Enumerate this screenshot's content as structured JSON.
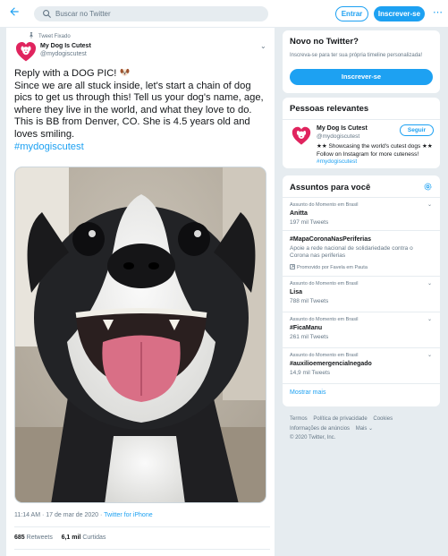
{
  "topbar": {
    "search_placeholder": "Buscar no Twitter",
    "login_label": "Entrar",
    "signup_label": "Inscrever-se",
    "more_icon": "more-dots-icon"
  },
  "tweet": {
    "pinned_label": "Tweet Fixado",
    "author_name": "My Dog Is Cutest",
    "author_handle": "@mydogiscutest",
    "text_line1": "Reply with a DOG PIC!",
    "text_body": "Since we are all stuck inside, let's start a chain of dog pics to get us through this! Tell us your dog's name, age, where they live in the world, and what they love to do. This is BB from Denver, CO. She is 4.5 years old and loves smiling.",
    "hashtag": "#mydogiscutest",
    "timestamp": "11:14 AM · 17 de mar de 2020 · ",
    "client": "Twitter for iPhone",
    "retweets_count": "685",
    "retweets_label": "Retweets",
    "likes_count": "6,1 mil",
    "likes_label": "Curtidas"
  },
  "new_to_twitter": {
    "title": "Novo no Twitter?",
    "subtitle": "Inscreva-se para ter sua própria timeline personalizada!",
    "cta": "Inscrever-se"
  },
  "people": {
    "title": "Pessoas relevantes",
    "name": "My Dog Is Cutest",
    "handle": "@mydogiscutest",
    "bio": "★★ Showcasing the world's cutest dogs ★★ Follow on Instagram for more cuteness! ",
    "bio_hashtag": "#mydogiscutest",
    "follow_label": "Seguir"
  },
  "trends": {
    "title": "Assuntos para você",
    "items": [
      {
        "context": "Assunto do Momento em Brasil",
        "name": "Anitta",
        "count": "197 mil Tweets"
      },
      {
        "context": "",
        "name": "#MapaCoronaNasPeriferias",
        "description": "Apoie a rede nacional de solidariedade contra o Corona nas periferias",
        "promo": "Promovido por Favela em Pauta"
      },
      {
        "context": "Assunto do Momento em Brasil",
        "name": "Lisa",
        "count": "788 mil Tweets"
      },
      {
        "context": "Assunto do Momento em Brasil",
        "name": "#FicaManu",
        "count": "261 mil Tweets"
      },
      {
        "context": "Assunto do Momento em Brasil",
        "name": "#auxilioemergencialnegado",
        "count": "14,9 mil Tweets"
      }
    ],
    "show_more": "Mostrar mais"
  },
  "footer": {
    "links": [
      "Termos",
      "Política de privacidade",
      "Cookies",
      "Informações de anúncios",
      "Mais ⌄"
    ],
    "copyright": "© 2020 Twitter, Inc."
  },
  "colors": {
    "accent": "#1da1f2",
    "background": "#e6ecf0",
    "brand_red": "#e0245e"
  }
}
